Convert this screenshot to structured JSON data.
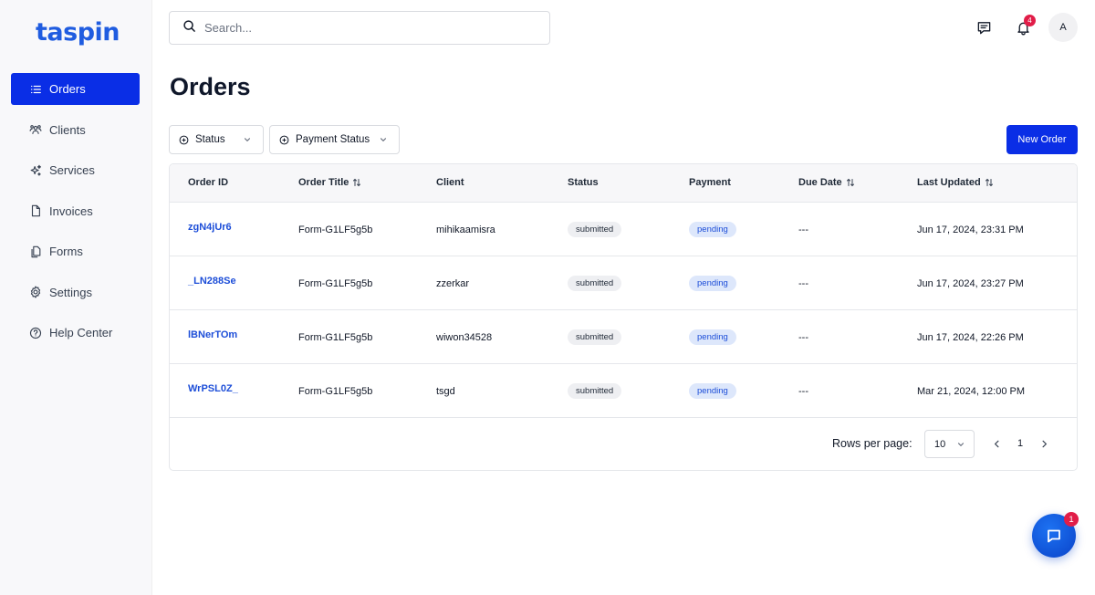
{
  "app": {
    "logo_text": "taspin"
  },
  "sidebar": {
    "items": [
      {
        "label": "Orders",
        "icon": "list-icon",
        "active": true
      },
      {
        "label": "Clients",
        "icon": "users-icon",
        "active": false
      },
      {
        "label": "Services",
        "icon": "sparkles-icon",
        "active": false
      },
      {
        "label": "Invoices",
        "icon": "file-icon",
        "active": false
      },
      {
        "label": "Forms",
        "icon": "files-icon",
        "active": false
      },
      {
        "label": "Settings",
        "icon": "gear-icon",
        "active": false
      },
      {
        "label": "Help Center",
        "icon": "help-circle-icon",
        "active": false
      }
    ]
  },
  "header": {
    "search_placeholder": "Search...",
    "notification_count": "4",
    "avatar_initial": "A"
  },
  "page": {
    "title": "Orders",
    "filters": {
      "status": "Status",
      "payment_status": "Payment Status"
    },
    "new_order_label": "New Order"
  },
  "table": {
    "columns": {
      "order_id": "Order ID",
      "order_title": "Order Title",
      "client": "Client",
      "status": "Status",
      "payment": "Payment",
      "due_date": "Due Date",
      "last_updated": "Last Updated"
    },
    "rows": [
      {
        "order_id": "zgN4jUr6",
        "order_title": "Form-G1LF5g5b",
        "client": "mihikaamisra",
        "status": "submitted",
        "payment": "pending",
        "due_date": "---",
        "last_updated": "Jun 17, 2024, 23:31 PM"
      },
      {
        "order_id": "_LN288Se",
        "order_title": "Form-G1LF5g5b",
        "client": "zzerkar",
        "status": "submitted",
        "payment": "pending",
        "due_date": "---",
        "last_updated": "Jun 17, 2024, 23:27 PM"
      },
      {
        "order_id": "lBNerTOm",
        "order_title": "Form-G1LF5g5b",
        "client": "wiwon34528",
        "status": "submitted",
        "payment": "pending",
        "due_date": "---",
        "last_updated": "Jun 17, 2024, 22:26 PM"
      },
      {
        "order_id": "WrPSL0Z_",
        "order_title": "Form-G1LF5g5b",
        "client": "tsgd",
        "status": "submitted",
        "payment": "pending",
        "due_date": "---",
        "last_updated": "Mar 21, 2024, 12:00 PM"
      }
    ]
  },
  "pagination": {
    "rows_per_page_label": "Rows per page:",
    "rows_per_page_value": "10",
    "current_page": "1"
  },
  "chat_widget": {
    "badge_count": "1"
  },
  "colors": {
    "primary": "#0a2ee6",
    "logo": "#1f5ce0",
    "link": "#1d4ed8",
    "badge": "#e11d48"
  }
}
